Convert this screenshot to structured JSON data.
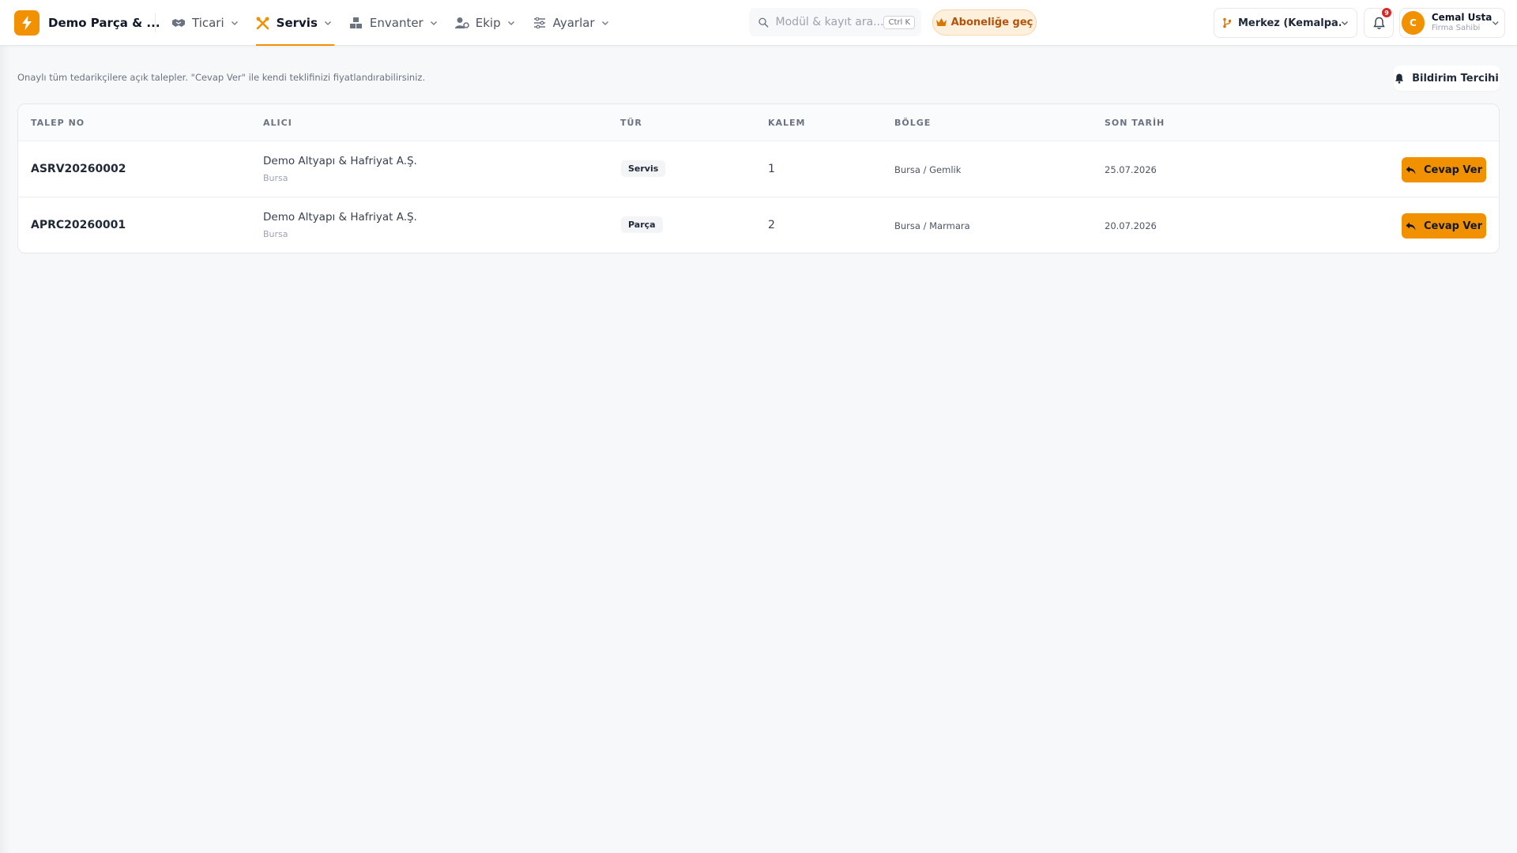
{
  "header": {
    "brand_name": "Demo Parça & ...",
    "nav": [
      {
        "label": "Ticari",
        "icon": "handshake-icon",
        "active": false
      },
      {
        "label": "Servis",
        "icon": "tools-icon",
        "active": true
      },
      {
        "label": "Envanter",
        "icon": "boxes-icon",
        "active": false
      },
      {
        "label": "Ekip",
        "icon": "user-gear-icon",
        "active": false
      },
      {
        "label": "Ayarlar",
        "icon": "sliders-icon",
        "active": false
      }
    ],
    "search_placeholder": "Modül & kayıt ara...",
    "search_shortcut": "Ctrl K",
    "upgrade_label": "Aboneliğe geç",
    "branch_label": "Merkez (Kemalpa...",
    "notification_count": "9",
    "user": {
      "initial": "C",
      "name": "Cemal Usta",
      "role": "Firma Sahibi"
    }
  },
  "main": {
    "info_text": "Onaylı tüm tedarikçilere açık talepler. \"Cevap Ver\" ile kendi teklifinizi fiyatlandırabilirsiniz.",
    "notification_pref_label": "Bildirim Tercihi",
    "table": {
      "columns": [
        "TALEP NO",
        "ALICI",
        "TÜR",
        "KALEM",
        "BÖLGE",
        "SON TARİH"
      ],
      "rows": [
        {
          "request_no": "ASRV20260002",
          "buyer": "Demo Altyapı & Hafriyat A.Ş.",
          "buyer_city": "Bursa",
          "type": "Servis",
          "items": "1",
          "region": "Bursa / Gemlik",
          "deadline": "25.07.2026",
          "action": "Cevap Ver"
        },
        {
          "request_no": "APRC20260001",
          "buyer": "Demo Altyapı & Hafriyat A.Ş.",
          "buyer_city": "Bursa",
          "type": "Parça",
          "items": "2",
          "region": "Bursa / Marmara",
          "deadline": "20.07.2026",
          "action": "Cevap Ver"
        }
      ]
    }
  },
  "colors": {
    "accent": "#f29100",
    "badge": "#dc2626",
    "background": "#f7f8fa"
  }
}
